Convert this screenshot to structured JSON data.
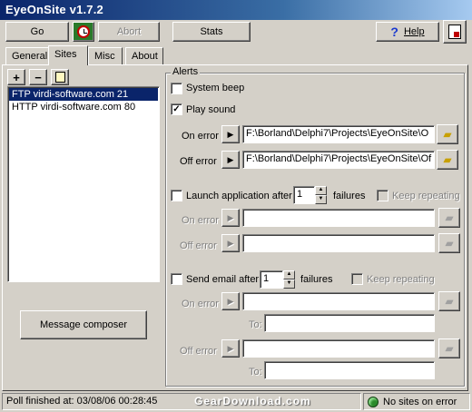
{
  "window": {
    "title": "EyeOnSite v1.7.2"
  },
  "toolbar": {
    "go_label": "Go",
    "abort_label": "Abort",
    "stats_label": "Stats",
    "help_label": "Help"
  },
  "tabs": [
    "General",
    "Sites",
    "Misc",
    "About"
  ],
  "sites_panel": {
    "items": [
      "FTP virdi-software.com 21",
      "HTTP virdi-software.com 80"
    ],
    "selected_index": 0,
    "message_composer_label": "Message composer"
  },
  "alerts": {
    "legend": "Alerts",
    "system_beep": {
      "label": "System beep",
      "checked": false
    },
    "play_sound": {
      "label": "Play sound",
      "checked": true,
      "on_error_label": "On error",
      "on_error_value": "F:\\Borland\\Delphi7\\Projects\\EyeOnSite\\O",
      "off_error_label": "Off error",
      "off_error_value": "F:\\Borland\\Delphi7\\Projects\\EyeOnSite\\Of"
    },
    "launch_app": {
      "label": "Launch application after",
      "count": "1",
      "failures_label": "failures",
      "keep_repeating_label": "Keep repeating",
      "on_error_label": "On error",
      "off_error_label": "Off error"
    },
    "send_email": {
      "label": "Send email after",
      "count": "1",
      "failures_label": "failures",
      "keep_repeating_label": "Keep repeating",
      "on_error_label": "On error",
      "off_error_label": "Off error",
      "to_label": "To:"
    }
  },
  "statusbar": {
    "poll_text": "Poll finished at: 03/08/06 00:28:45",
    "watermark": "GearDownload.com",
    "status_text": "No sites on error"
  },
  "colors": {
    "title_start": "#0a246a",
    "title_end": "#a6caf0",
    "face": "#d4d0c8",
    "selection": "#0a246a",
    "status_led": "#2a8a2a"
  }
}
